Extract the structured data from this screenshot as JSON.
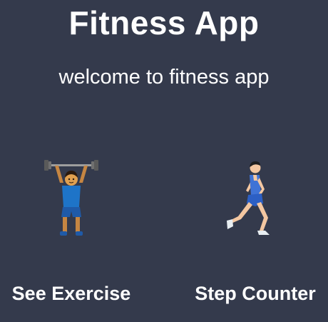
{
  "header": {
    "title": "Fitness App",
    "subtitle": "welcome to fitness app"
  },
  "background_color": "#343a4c",
  "options": [
    {
      "label": "See Exercise",
      "icon": "weightlifter-icon"
    },
    {
      "label": "Step Counter",
      "icon": "runner-icon"
    }
  ]
}
